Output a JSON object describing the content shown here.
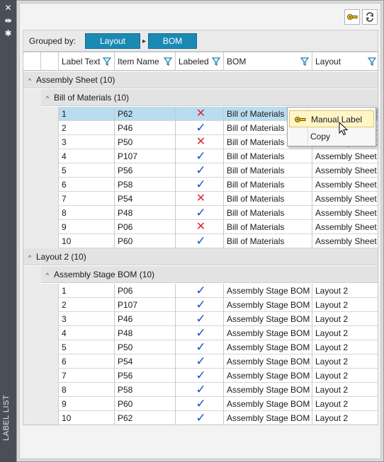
{
  "panel": {
    "title": "LABEL LIST",
    "close_glyph": "✕",
    "pin_glyph": "⇹",
    "settings_glyph": "✱"
  },
  "toolbar": {
    "buttons": [
      {
        "name": "manual-label-tool",
        "icon": "manual-label-icon"
      },
      {
        "name": "sync-tool",
        "icon": "sync-icon"
      }
    ]
  },
  "grouping": {
    "label": "Grouped by:",
    "chips": [
      {
        "label": "Layout",
        "sort": "^"
      },
      {
        "label": "BOM",
        "sort": "^"
      }
    ],
    "separator": "▸"
  },
  "columns": [
    {
      "label": "Label Text",
      "filter": true
    },
    {
      "label": "Item Name",
      "filter": true
    },
    {
      "label": "Labeled",
      "filter": true
    },
    {
      "label": "BOM",
      "filter": true
    },
    {
      "label": "Layout",
      "filter": true
    }
  ],
  "groups": [
    {
      "label": "Assembly Sheet (10)",
      "subgroup": {
        "label": "Bill of Materials (10)",
        "rows": [
          {
            "label_text": "1",
            "item": "P62",
            "labeled": false,
            "bom": "Bill of Materials",
            "layout": "Assembly Sheet",
            "selected": true
          },
          {
            "label_text": "2",
            "item": "P46",
            "labeled": true,
            "bom": "Bill of Materials",
            "layout": "Assembly Sheet"
          },
          {
            "label_text": "3",
            "item": "P50",
            "labeled": false,
            "bom": "Bill of Materials",
            "layout": "Assembly Sheet"
          },
          {
            "label_text": "4",
            "item": "P107",
            "labeled": true,
            "bom": "Bill of Materials",
            "layout": "Assembly Sheet"
          },
          {
            "label_text": "5",
            "item": "P56",
            "labeled": true,
            "bom": "Bill of Materials",
            "layout": "Assembly Sheet"
          },
          {
            "label_text": "6",
            "item": "P58",
            "labeled": true,
            "bom": "Bill of Materials",
            "layout": "Assembly Sheet"
          },
          {
            "label_text": "7",
            "item": "P54",
            "labeled": false,
            "bom": "Bill of Materials",
            "layout": "Assembly Sheet"
          },
          {
            "label_text": "8",
            "item": "P48",
            "labeled": true,
            "bom": "Bill of Materials",
            "layout": "Assembly Sheet"
          },
          {
            "label_text": "9",
            "item": "P06",
            "labeled": false,
            "bom": "Bill of Materials",
            "layout": "Assembly Sheet"
          },
          {
            "label_text": "10",
            "item": "P60",
            "labeled": true,
            "bom": "Bill of Materials",
            "layout": "Assembly Sheet"
          }
        ]
      }
    },
    {
      "label": "Layout 2 (10)",
      "subgroup": {
        "label": "Assembly Stage BOM (10)",
        "rows": [
          {
            "label_text": "1",
            "item": "P06",
            "labeled": true,
            "bom": "Assembly Stage BOM",
            "layout": "Layout 2"
          },
          {
            "label_text": "2",
            "item": "P107",
            "labeled": true,
            "bom": "Assembly Stage BOM",
            "layout": "Layout 2"
          },
          {
            "label_text": "3",
            "item": "P46",
            "labeled": true,
            "bom": "Assembly Stage BOM",
            "layout": "Layout 2"
          },
          {
            "label_text": "4",
            "item": "P48",
            "labeled": true,
            "bom": "Assembly Stage BOM",
            "layout": "Layout 2"
          },
          {
            "label_text": "5",
            "item": "P50",
            "labeled": true,
            "bom": "Assembly Stage BOM",
            "layout": "Layout 2"
          },
          {
            "label_text": "6",
            "item": "P54",
            "labeled": true,
            "bom": "Assembly Stage BOM",
            "layout": "Layout 2"
          },
          {
            "label_text": "7",
            "item": "P56",
            "labeled": true,
            "bom": "Assembly Stage BOM",
            "layout": "Layout 2"
          },
          {
            "label_text": "8",
            "item": "P58",
            "labeled": true,
            "bom": "Assembly Stage BOM",
            "layout": "Layout 2"
          },
          {
            "label_text": "9",
            "item": "P60",
            "labeled": true,
            "bom": "Assembly Stage BOM",
            "layout": "Layout 2"
          },
          {
            "label_text": "10",
            "item": "P62",
            "labeled": true,
            "bom": "Assembly Stage BOM",
            "layout": "Layout 2"
          }
        ]
      }
    }
  ],
  "context_menu": {
    "items": [
      {
        "label": "Manual Label",
        "icon": "manual-label-icon",
        "highlighted": true
      },
      {
        "label": "Copy",
        "icon": "",
        "highlighted": false
      }
    ]
  },
  "glyphs": {
    "check": "✓",
    "cross": "✕",
    "caret": "^"
  },
  "colors": {
    "accent": "#1a8ab5",
    "check": "#1a4fcf",
    "cross": "#d6273a",
    "selected_row": "#b9dcef"
  }
}
